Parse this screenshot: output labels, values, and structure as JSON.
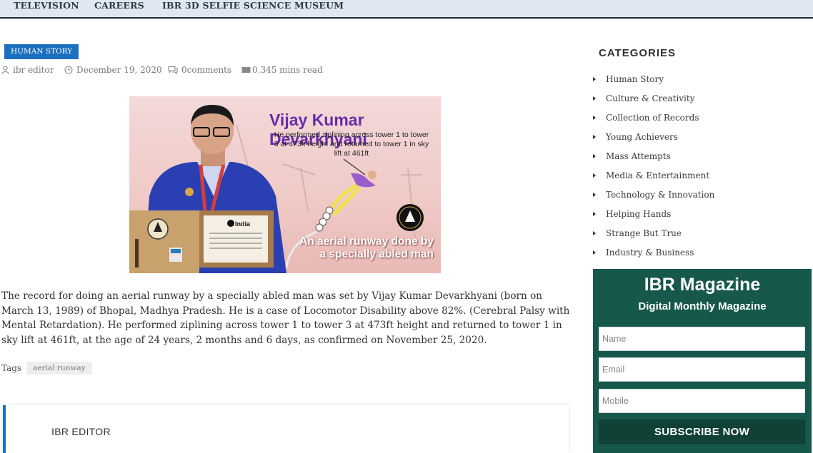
{
  "nav": {
    "items": [
      "TELEVISION",
      "CAREERS",
      "IBR 3D SELFIE SCIENCE MUSEUM"
    ]
  },
  "article": {
    "category_badge": "HUMAN STORY",
    "author": "ibr editor",
    "date": "December 19, 2020",
    "comments": "0comments",
    "read_time": "0.345 mins read",
    "image": {
      "name": "Vijay Kumar Devarkhyani",
      "subtitle": "He performed ziplining across tower 1 to tower 3 at 473ft height and returned to tower 1 in sky lift at 461ft",
      "caption": "An aerial runway done by a specially abled man",
      "certificate_text": "India"
    },
    "body": "The record for doing an aerial runway by a specially abled man was set by Vijay Kumar Devarkhyani (born on March 13, 1989) of Bhopal, Madhya Pradesh. He is a case of Locomotor Disability above 82%. (Cerebral Palsy with Mental Retardation). He performed ziplining across tower 1 to tower 3 at 473ft height and returned to tower 1 in sky lift at 461ft, at the age of 24 years, 2 months and 6 days, as confirmed on November 25, 2020.",
    "tags_label": "Tags",
    "tags": [
      "aerial runway"
    ]
  },
  "author_box": {
    "name": "IBR EDITOR"
  },
  "sidebar": {
    "categories_title": "CATEGORIES",
    "categories": [
      "Human Story",
      "Culture & Creativity",
      "Collection of Records",
      "Young Achievers",
      "Mass Attempts",
      "Media & Entertainment",
      "Technology & Innovation",
      "Helping Hands",
      "Strange But True",
      "Industry & Business"
    ]
  },
  "magazine": {
    "title": "IBR Magazine",
    "subtitle": "Digital Monthly Magazine",
    "name_placeholder": "Name",
    "email_placeholder": "Email",
    "mobile_placeholder": "Mobile",
    "button_label": "SUBSCRIBE NOW"
  },
  "colors": {
    "badge_blue": "#1b6fbf",
    "nav_bg": "#dfe8f0",
    "magazine_green": "#16584b",
    "button_green": "#0f4137"
  }
}
